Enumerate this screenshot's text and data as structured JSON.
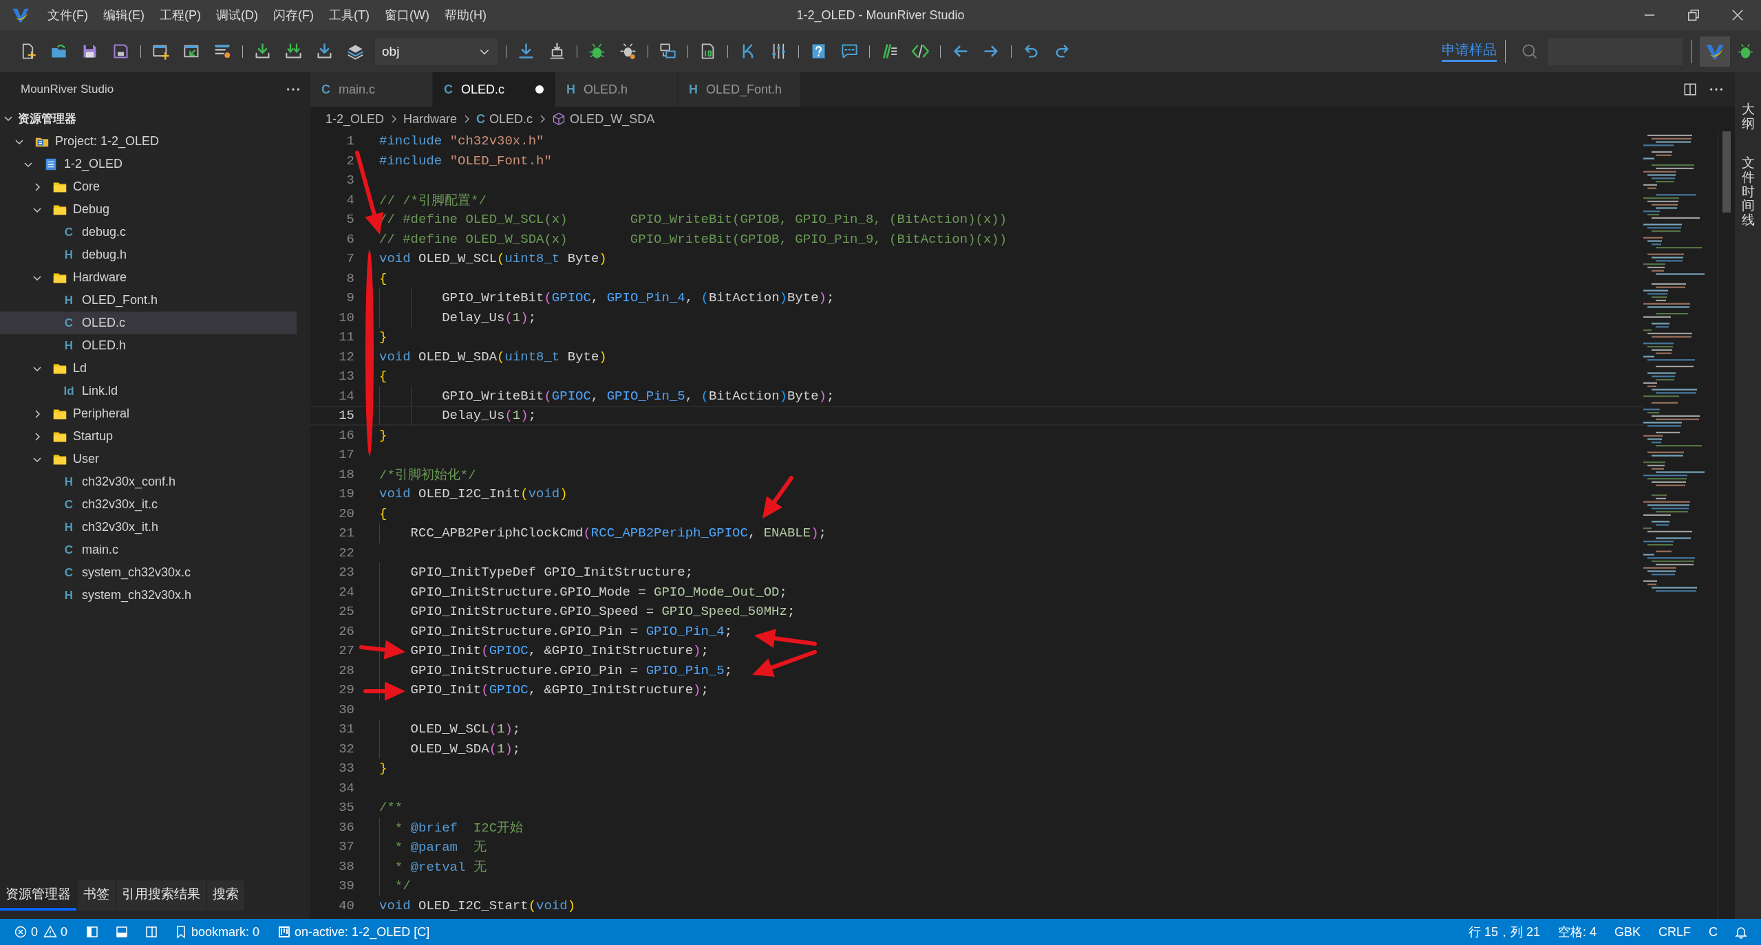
{
  "window": {
    "title": "1-2_OLED - MounRiver Studio"
  },
  "menu": [
    "文件(F)",
    "编辑(E)",
    "工程(P)",
    "调试(D)",
    "闪存(F)",
    "工具(T)",
    "窗口(W)",
    "帮助(H)"
  ],
  "toolbar": {
    "config": "obj",
    "sample_link": "申请样品"
  },
  "sidebar": {
    "title": "MounRiver Studio",
    "section": {
      "label": "资源管理器",
      "expanded": true
    },
    "tree": [
      {
        "label": "Project: 1-2_OLED",
        "kind": "project",
        "expanded": true,
        "selected": false,
        "children": [
          {
            "label": "1-2_OLED",
            "kind": "module",
            "expanded": true,
            "selected": false,
            "children": [
              {
                "label": "Core",
                "kind": "folder",
                "expanded": false,
                "selected": false
              },
              {
                "label": "Debug",
                "kind": "folder",
                "expanded": true,
                "selected": false,
                "children": [
                  {
                    "label": "debug.c",
                    "kind": "file",
                    "icon": "C",
                    "selected": false
                  },
                  {
                    "label": "debug.h",
                    "kind": "file",
                    "icon": "H",
                    "selected": false
                  }
                ]
              },
              {
                "label": "Hardware",
                "kind": "folder",
                "expanded": true,
                "selected": false,
                "children": [
                  {
                    "label": "OLED_Font.h",
                    "kind": "file",
                    "icon": "H",
                    "selected": false
                  },
                  {
                    "label": "OLED.c",
                    "kind": "file",
                    "icon": "C",
                    "selected": true
                  },
                  {
                    "label": "OLED.h",
                    "kind": "file",
                    "icon": "H",
                    "selected": false
                  }
                ]
              },
              {
                "label": "Ld",
                "kind": "folder",
                "expanded": true,
                "selected": false,
                "children": [
                  {
                    "label": "Link.ld",
                    "kind": "file",
                    "icon": "Id",
                    "selected": false
                  }
                ]
              },
              {
                "label": "Peripheral",
                "kind": "folder",
                "expanded": false,
                "selected": false
              },
              {
                "label": "Startup",
                "kind": "folder",
                "expanded": false,
                "selected": false
              },
              {
                "label": "User",
                "kind": "folder",
                "expanded": true,
                "selected": false,
                "children": [
                  {
                    "label": "ch32v30x_conf.h",
                    "kind": "file",
                    "icon": "H",
                    "selected": false
                  },
                  {
                    "label": "ch32v30x_it.c",
                    "kind": "file",
                    "icon": "C",
                    "selected": false
                  },
                  {
                    "label": "ch32v30x_it.h",
                    "kind": "file",
                    "icon": "H",
                    "selected": false
                  },
                  {
                    "label": "main.c",
                    "kind": "file",
                    "icon": "C",
                    "selected": false
                  },
                  {
                    "label": "system_ch32v30x.c",
                    "kind": "file",
                    "icon": "C",
                    "selected": false
                  },
                  {
                    "label": "system_ch32v30x.h",
                    "kind": "file",
                    "icon": "H",
                    "selected": false
                  }
                ]
              }
            ]
          }
        ]
      }
    ],
    "bottom_tabs": [
      {
        "label": "资源管理器",
        "selected": true
      },
      {
        "label": "书签",
        "selected": false
      },
      {
        "label": "引用搜索结果",
        "selected": false
      },
      {
        "label": "搜索",
        "selected": false
      }
    ]
  },
  "editor": {
    "tabs": [
      {
        "icon": "C",
        "label": "main.c",
        "selected": false,
        "modified": false
      },
      {
        "icon": "C",
        "label": "OLED.c",
        "selected": true,
        "modified": true
      },
      {
        "icon": "H",
        "label": "OLED.h",
        "selected": false,
        "modified": false
      },
      {
        "icon": "H",
        "label": "OLED_Font.h",
        "selected": false,
        "modified": false
      }
    ],
    "breadcrumb": [
      {
        "label": "1-2_OLED",
        "kind": "folder"
      },
      {
        "label": "Hardware",
        "kind": "folder"
      },
      {
        "label": "OLED.c",
        "kind": "file",
        "icon": "C"
      },
      {
        "label": "OLED_W_SDA",
        "kind": "symbol"
      }
    ],
    "lines": [
      {
        "n": "1",
        "current": false,
        "tokens": [
          {
            "kind": "keyword",
            "text": "#include "
          },
          {
            "kind": "string",
            "text": "\"ch32v30x.h\""
          }
        ]
      },
      {
        "n": "2",
        "current": false,
        "tokens": [
          {
            "kind": "keyword",
            "text": "#include "
          },
          {
            "kind": "string",
            "text": "\"OLED_Font.h\""
          }
        ]
      },
      {
        "n": "3",
        "current": false
      },
      {
        "n": "4",
        "current": false,
        "tokens": [
          {
            "kind": "comment",
            "text": "// /*引脚配置*/"
          }
        ]
      },
      {
        "n": "5",
        "current": false,
        "tokens": [
          {
            "kind": "comment",
            "text": "// #define OLED_W_SCL(x)        GPIO_WriteBit(GPIOB, GPIO_Pin_8, (BitAction)(x))"
          }
        ]
      },
      {
        "n": "6",
        "current": false,
        "tokens": [
          {
            "kind": "comment",
            "text": "// #define OLED_W_SDA(x)        GPIO_WriteBit(GPIOB, GPIO_Pin_9, (BitAction)(x))"
          }
        ]
      },
      {
        "n": "7",
        "current": false,
        "tokens": [
          {
            "kind": "keyword",
            "text": "void "
          },
          {
            "kind": "plain",
            "text": "OLED_W_SCL"
          },
          {
            "kind": "bracket1",
            "text": "("
          },
          {
            "kind": "keyword",
            "text": "uint8_t"
          },
          {
            "kind": "plain",
            "text": " Byte"
          },
          {
            "kind": "bracket1",
            "text": ")"
          }
        ]
      },
      {
        "n": "8",
        "current": false,
        "tokens": [
          {
            "kind": "bracket1",
            "text": "{"
          }
        ]
      },
      {
        "n": "9",
        "current": false,
        "tokens": [
          {
            "kind": "plain",
            "text": "        GPIO_WriteBit"
          },
          {
            "kind": "bracket2",
            "text": "("
          },
          {
            "kind": "macro",
            "text": "GPIOC"
          },
          {
            "kind": "plain",
            "text": ", "
          },
          {
            "kind": "macro",
            "text": "GPIO_Pin_4"
          },
          {
            "kind": "plain",
            "text": ", "
          },
          {
            "kind": "bracket3",
            "text": "("
          },
          {
            "kind": "plain",
            "text": "BitAction"
          },
          {
            "kind": "bracket3",
            "text": ")"
          },
          {
            "kind": "plain",
            "text": "Byte"
          },
          {
            "kind": "bracket2",
            "text": ")"
          },
          {
            "kind": "plain",
            "text": ";"
          }
        ]
      },
      {
        "n": "10",
        "current": false,
        "tokens": [
          {
            "kind": "plain",
            "text": "        Delay_Us"
          },
          {
            "kind": "bracket2",
            "text": "("
          },
          {
            "kind": "number",
            "text": "1"
          },
          {
            "kind": "bracket2",
            "text": ")"
          },
          {
            "kind": "plain",
            "text": ";"
          }
        ]
      },
      {
        "n": "11",
        "current": false,
        "tokens": [
          {
            "kind": "bracket1",
            "text": "}"
          }
        ]
      },
      {
        "n": "12",
        "current": false,
        "tokens": [
          {
            "kind": "keyword",
            "text": "void "
          },
          {
            "kind": "plain",
            "text": "OLED_W_SDA"
          },
          {
            "kind": "bracket1",
            "text": "("
          },
          {
            "kind": "keyword",
            "text": "uint8_t"
          },
          {
            "kind": "plain",
            "text": " Byte"
          },
          {
            "kind": "bracket1",
            "text": ")"
          }
        ]
      },
      {
        "n": "13",
        "current": false,
        "tokens": [
          {
            "kind": "bracket1",
            "text": "{"
          }
        ]
      },
      {
        "n": "14",
        "current": false,
        "tokens": [
          {
            "kind": "plain",
            "text": "        GPIO_WriteBit"
          },
          {
            "kind": "bracket2",
            "text": "("
          },
          {
            "kind": "macro",
            "text": "GPIOC"
          },
          {
            "kind": "plain",
            "text": ", "
          },
          {
            "kind": "macro",
            "text": "GPIO_Pin_5"
          },
          {
            "kind": "plain",
            "text": ", "
          },
          {
            "kind": "bracket3",
            "text": "("
          },
          {
            "kind": "plain",
            "text": "BitAction"
          },
          {
            "kind": "bracket3",
            "text": ")"
          },
          {
            "kind": "plain",
            "text": "Byte"
          },
          {
            "kind": "bracket2",
            "text": ")"
          },
          {
            "kind": "plain",
            "text": ";"
          }
        ]
      },
      {
        "n": "15",
        "current": true,
        "tokens": [
          {
            "kind": "plain",
            "text": "        Delay_Us"
          },
          {
            "kind": "bracket2",
            "text": "("
          },
          {
            "kind": "number",
            "text": "1"
          },
          {
            "kind": "bracket2",
            "text": ")"
          },
          {
            "kind": "plain",
            "text": ";"
          }
        ]
      },
      {
        "n": "16",
        "current": false,
        "tokens": [
          {
            "kind": "bracket1",
            "text": "}"
          }
        ]
      },
      {
        "n": "17",
        "current": false
      },
      {
        "n": "18",
        "current": false,
        "tokens": [
          {
            "kind": "comment",
            "text": "/*引脚初始化*/"
          }
        ]
      },
      {
        "n": "19",
        "current": false,
        "tokens": [
          {
            "kind": "keyword",
            "text": "void "
          },
          {
            "kind": "plain",
            "text": "OLED_I2C_Init"
          },
          {
            "kind": "bracket1",
            "text": "("
          },
          {
            "kind": "keyword",
            "text": "void"
          },
          {
            "kind": "bracket1",
            "text": ")"
          }
        ]
      },
      {
        "n": "20",
        "current": false,
        "tokens": [
          {
            "kind": "bracket1",
            "text": "{"
          }
        ]
      },
      {
        "n": "21",
        "current": false,
        "tokens": [
          {
            "kind": "plain",
            "text": "    RCC_APB2PeriphClockCmd"
          },
          {
            "kind": "bracket2",
            "text": "("
          },
          {
            "kind": "macro",
            "text": "RCC_APB2Periph_GPIOC"
          },
          {
            "kind": "plain",
            "text": ", "
          },
          {
            "kind": "enum",
            "text": "ENABLE"
          },
          {
            "kind": "bracket2",
            "text": ")"
          },
          {
            "kind": "plain",
            "text": ";"
          }
        ]
      },
      {
        "n": "22",
        "current": false
      },
      {
        "n": "23",
        "current": false,
        "tokens": [
          {
            "kind": "plain",
            "text": "    GPIO_InitTypeDef GPIO_InitStructure;"
          }
        ]
      },
      {
        "n": "24",
        "current": false,
        "tokens": [
          {
            "kind": "plain",
            "text": "    GPIO_InitStructure.GPIO_Mode = "
          },
          {
            "kind": "enum",
            "text": "GPIO_Mode_Out_OD"
          },
          {
            "kind": "plain",
            "text": ";"
          }
        ]
      },
      {
        "n": "25",
        "current": false,
        "tokens": [
          {
            "kind": "plain",
            "text": "    GPIO_InitStructure.GPIO_Speed = "
          },
          {
            "kind": "enum",
            "text": "GPIO_Speed_50MHz"
          },
          {
            "kind": "plain",
            "text": ";"
          }
        ]
      },
      {
        "n": "26",
        "current": false,
        "tokens": [
          {
            "kind": "plain",
            "text": "    GPIO_InitStructure.GPIO_Pin = "
          },
          {
            "kind": "macro",
            "text": "GPIO_Pin_4"
          },
          {
            "kind": "plain",
            "text": ";"
          }
        ]
      },
      {
        "n": "27",
        "current": false,
        "tokens": [
          {
            "kind": "plain",
            "text": "    GPIO_Init"
          },
          {
            "kind": "bracket2",
            "text": "("
          },
          {
            "kind": "macro",
            "text": "GPIOC"
          },
          {
            "kind": "plain",
            "text": ", &GPIO_InitStructure"
          },
          {
            "kind": "bracket2",
            "text": ")"
          },
          {
            "kind": "plain",
            "text": ";"
          }
        ]
      },
      {
        "n": "28",
        "current": false,
        "tokens": [
          {
            "kind": "plain",
            "text": "    GPIO_InitStructure.GPIO_Pin = "
          },
          {
            "kind": "macro",
            "text": "GPIO_Pin_5"
          },
          {
            "kind": "plain",
            "text": ";"
          }
        ]
      },
      {
        "n": "29",
        "current": false,
        "tokens": [
          {
            "kind": "plain",
            "text": "    GPIO_Init"
          },
          {
            "kind": "bracket2",
            "text": "("
          },
          {
            "kind": "macro",
            "text": "GPIOC"
          },
          {
            "kind": "plain",
            "text": ", &GPIO_InitStructure"
          },
          {
            "kind": "bracket2",
            "text": ")"
          },
          {
            "kind": "plain",
            "text": ";"
          }
        ]
      },
      {
        "n": "30",
        "current": false
      },
      {
        "n": "31",
        "current": false,
        "tokens": [
          {
            "kind": "plain",
            "text": "    OLED_W_SCL"
          },
          {
            "kind": "bracket2",
            "text": "("
          },
          {
            "kind": "number",
            "text": "1"
          },
          {
            "kind": "bracket2",
            "text": ")"
          },
          {
            "kind": "plain",
            "text": ";"
          }
        ]
      },
      {
        "n": "32",
        "current": false,
        "tokens": [
          {
            "kind": "plain",
            "text": "    OLED_W_SDA"
          },
          {
            "kind": "bracket2",
            "text": "("
          },
          {
            "kind": "number",
            "text": "1"
          },
          {
            "kind": "bracket2",
            "text": ")"
          },
          {
            "kind": "plain",
            "text": ";"
          }
        ]
      },
      {
        "n": "33",
        "current": false,
        "tokens": [
          {
            "kind": "bracket1",
            "text": "}"
          }
        ]
      },
      {
        "n": "34",
        "current": false
      },
      {
        "n": "35",
        "current": false,
        "tokens": [
          {
            "kind": "comment",
            "text": "/**"
          }
        ]
      },
      {
        "n": "36",
        "current": false,
        "tokens": [
          {
            "kind": "comment",
            "text": "  * "
          },
          {
            "kind": "doctag",
            "text": "@brief"
          },
          {
            "kind": "comment",
            "text": "  I2C开始"
          }
        ]
      },
      {
        "n": "37",
        "current": false,
        "tokens": [
          {
            "kind": "comment",
            "text": "  * "
          },
          {
            "kind": "doctag",
            "text": "@param"
          },
          {
            "kind": "comment",
            "text": "  无"
          }
        ]
      },
      {
        "n": "38",
        "current": false,
        "tokens": [
          {
            "kind": "comment",
            "text": "  * "
          },
          {
            "kind": "doctag",
            "text": "@retval"
          },
          {
            "kind": "comment",
            "text": " 无"
          }
        ]
      },
      {
        "n": "39",
        "current": false,
        "tokens": [
          {
            "kind": "comment",
            "text": "  */"
          }
        ]
      },
      {
        "n": "40",
        "current": false,
        "tokens": [
          {
            "kind": "keyword",
            "text": "void "
          },
          {
            "kind": "plain",
            "text": "OLED_I2C_Start"
          },
          {
            "kind": "bracket1",
            "text": "("
          },
          {
            "kind": "keyword",
            "text": "void"
          },
          {
            "kind": "bracket1",
            "text": ")"
          }
        ]
      }
    ]
  },
  "side_panel": [
    {
      "label": "大纲"
    },
    {
      "label": "文件时间线"
    }
  ],
  "status_bar": {
    "errors": "0",
    "warnings": "0",
    "bookmark": "bookmark: 0",
    "target": "on-active: 1-2_OLED [C]",
    "position": "行 15，列 21",
    "indent": "空格: 4",
    "encoding": "GBK",
    "eol": "CRLF",
    "language": "C"
  }
}
